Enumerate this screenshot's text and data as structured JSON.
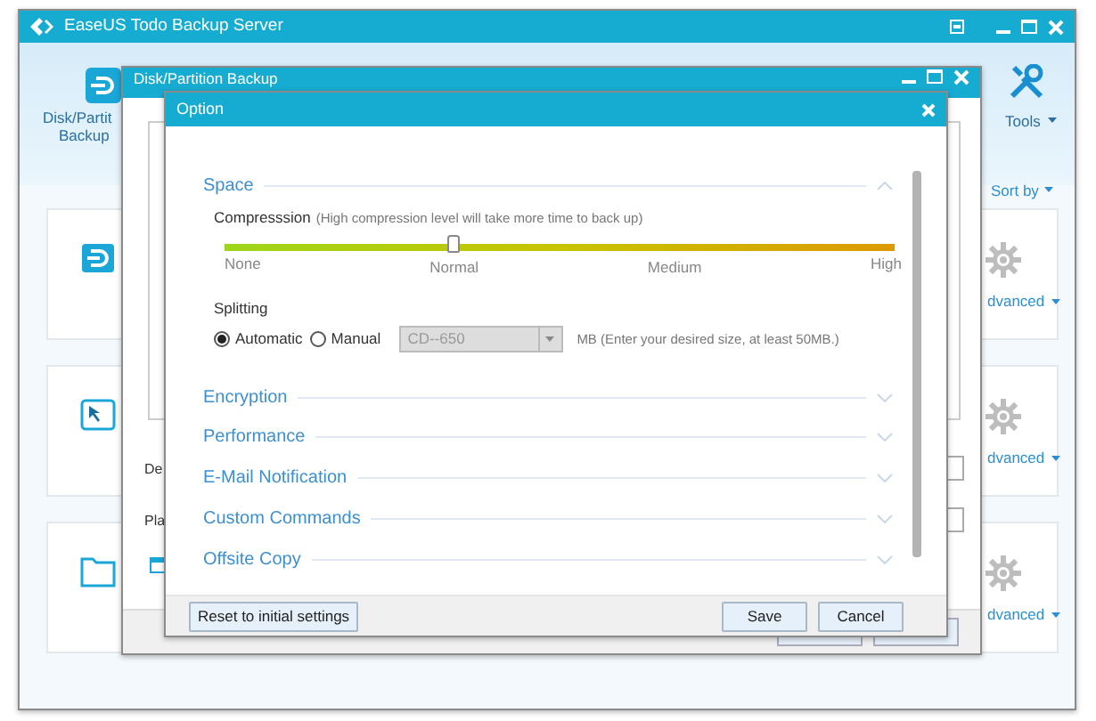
{
  "main_window": {
    "title": "EaseUS Todo Backup Server",
    "toolbar": {
      "backup_label": [
        "Disk/Partit",
        "Backup"
      ],
      "tools_label": "Tools"
    },
    "sort_by": "Sort by",
    "task_cards": [
      {
        "kind": "disk",
        "advanced": "dvanced"
      },
      {
        "kind": "cursor",
        "advanced": "dvanced"
      },
      {
        "kind": "folder",
        "advanced": "dvanced"
      }
    ]
  },
  "backup_dialog": {
    "title": "Disk/Partition Backup",
    "labels": [
      "De",
      "Pla"
    ]
  },
  "option_dialog": {
    "title": "Option",
    "sections": [
      {
        "title": "Space",
        "expanded": true,
        "content": {
          "compression": {
            "label": "Compresssion",
            "hint": "(High compression level will take more time to back up)",
            "level": 0.34,
            "ticks": [
              "None",
              "Normal",
              "Medium",
              "High"
            ]
          },
          "splitting": {
            "label": "Splitting",
            "options": [
              {
                "label": "Automatic",
                "selected": true
              },
              {
                "label": "Manual",
                "selected": false
              }
            ],
            "size_combo": {
              "value": "CD--650",
              "disabled": true
            },
            "unit_hint": "MB (Enter your desired size, at least 50MB.)"
          }
        }
      },
      {
        "title": "Encryption",
        "expanded": false
      },
      {
        "title": "Performance",
        "expanded": false
      },
      {
        "title": "E-Mail Notification",
        "expanded": false
      },
      {
        "title": "Custom Commands",
        "expanded": false
      },
      {
        "title": "Offsite Copy",
        "expanded": false
      }
    ],
    "buttons": {
      "reset": "Reset to initial settings",
      "save": "Save",
      "cancel": "Cancel"
    }
  }
}
